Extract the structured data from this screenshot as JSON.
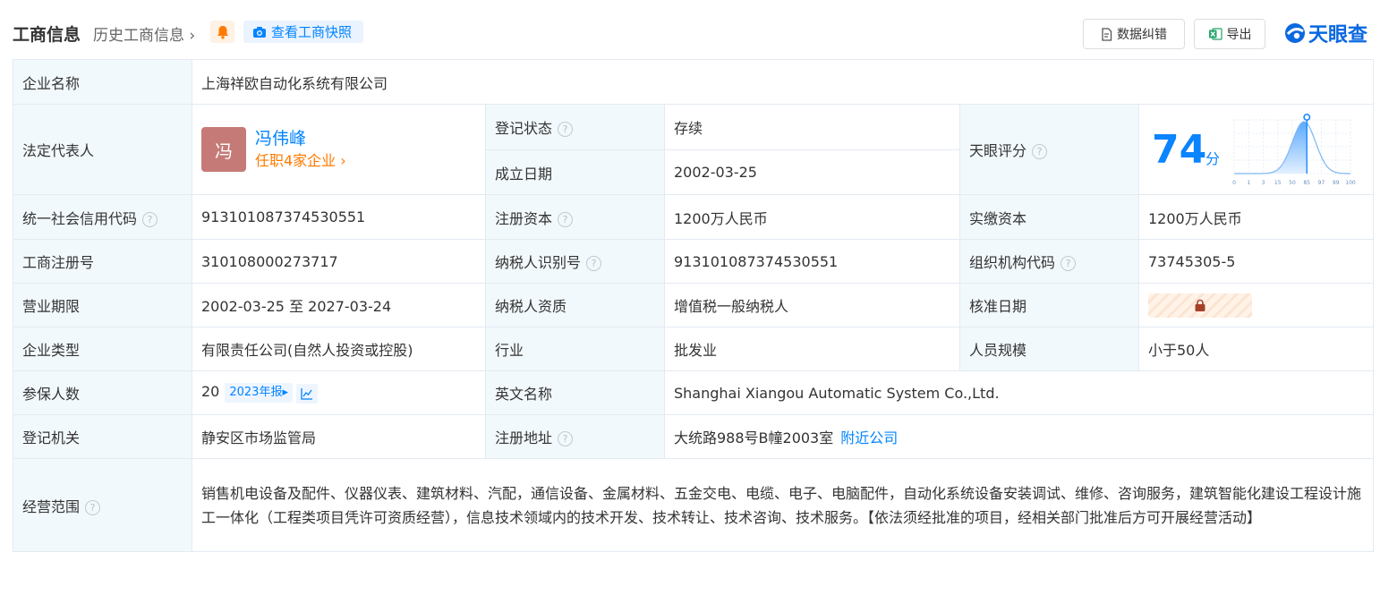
{
  "header": {
    "title": "工商信息",
    "history_label": "历史工商信息",
    "history_chevron": "›",
    "snapshot_label": "查看工商快照",
    "correct_label": "数据纠错",
    "export_label": "导出",
    "logo_text": "天眼查",
    "icons": [
      "bell-icon",
      "camera-icon",
      "document-icon",
      "excel-icon",
      "tianyancha-logo"
    ]
  },
  "company": {
    "name_label": "企业名称",
    "name": "上海祥欧自动化系统有限公司",
    "rep_label": "法定代表人",
    "rep_avatar": "冯",
    "rep_name": "冯伟峰",
    "rep_link": "任职4家企业",
    "rep_link_chevron": "›",
    "status_label": "登记状态",
    "status": "存续",
    "founded_label": "成立日期",
    "founded": "2002-03-25",
    "score_label": "天眼评分",
    "score_value": "74",
    "score_unit": "分",
    "credit_code_label": "统一社会信用代码",
    "credit_code": "913101087374530551",
    "reg_capital_label": "注册资本",
    "reg_capital": "1200万人民币",
    "paid_capital_label": "实缴资本",
    "paid_capital": "1200万人民币",
    "reg_no_label": "工商注册号",
    "reg_no": "310108000273717",
    "taxpayer_id_label": "纳税人识别号",
    "taxpayer_id": "913101087374530551",
    "org_code_label": "组织机构代码",
    "org_code": "73745305-5",
    "term_label": "营业期限",
    "term": "2002-03-25 至 2027-03-24",
    "taxpayer_qual_label": "纳税人资质",
    "taxpayer_qual": "增值税一般纳税人",
    "approval_label": "核准日期",
    "type_label": "企业类型",
    "type": "有限责任公司(自然人投资或控股)",
    "industry_label": "行业",
    "industry": "批发业",
    "staff_label": "人员规模",
    "staff": "小于50人",
    "insured_label": "参保人数",
    "insured": "20",
    "insured_year": "2023年报",
    "insured_year_arrow": "▸",
    "en_name_label": "英文名称",
    "en_name": "Shanghai Xiangou Automatic System Co.,Ltd.",
    "authority_label": "登记机关",
    "authority": "静安区市场监管局",
    "address_label": "注册地址",
    "address": "大统路988号B幢2003室",
    "nearby_label": "附近公司",
    "scope_label": "经营范围",
    "scope": "销售机电设备及配件、仪器仪表、建筑材料、汽配，通信设备、金属材料、五金交电、电缆、电子、电脑配件，自动化系统设备安装调试、维修、咨询服务，建筑智能化建设工程设计施工一体化（工程类项目凭许可资质经营），信息技术领域内的技术开发、技术转让、技术咨询、技术服务。【依法须经批准的项目，经相关部门批准后方可开展经营活动】",
    "help_mark": "?"
  },
  "score_chart": {
    "ticks": [
      "0",
      "1",
      "3",
      "15",
      "50",
      "85",
      "97",
      "99",
      "100"
    ],
    "marker_tick": "85",
    "colors": {
      "accent": "#0a84ff",
      "fill_top": "#5aa9ff",
      "fill_bottom": "#e4f0ff"
    }
  },
  "colors": {
    "label_bg": "#f2f9fc",
    "border": "#e4eaf2",
    "link": "#0084ff",
    "orange": "#ff7a00",
    "green": "#00a03e",
    "avatar": "#c67a78"
  }
}
